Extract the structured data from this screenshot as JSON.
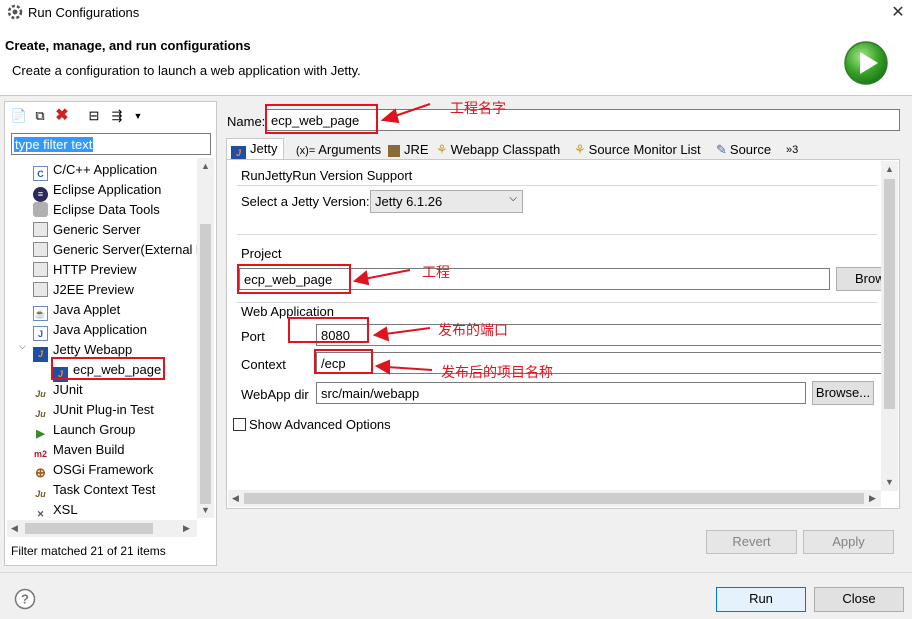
{
  "window": {
    "title": "Run Configurations",
    "close": "✕"
  },
  "header": {
    "title": "Create, manage, and run configurations",
    "subtitle": "Create a configuration to launch a web application with Jetty."
  },
  "left": {
    "filter_text": "type filter text",
    "tree": [
      {
        "label": "C/C++ Application",
        "icon": "c-icon"
      },
      {
        "label": "Eclipse Application",
        "icon": "eclipse-icon"
      },
      {
        "label": "Eclipse Data Tools",
        "icon": "database-icon"
      },
      {
        "label": "Generic Server",
        "icon": "server-icon"
      },
      {
        "label": "Generic Server(External l",
        "icon": "server-icon"
      },
      {
        "label": "HTTP Preview",
        "icon": "server-icon"
      },
      {
        "label": "J2EE Preview",
        "icon": "server-icon"
      },
      {
        "label": "Java Applet",
        "icon": "applet-icon"
      },
      {
        "label": "Java Application",
        "icon": "java-app-icon"
      },
      {
        "label": "Jetty Webapp",
        "icon": "jetty-icon"
      },
      {
        "label": "ecp_web_page",
        "icon": "jetty-icon"
      },
      {
        "label": "JUnit",
        "icon": "junit-icon"
      },
      {
        "label": "JUnit Plug-in Test",
        "icon": "junit-plugin-icon"
      },
      {
        "label": "Launch Group",
        "icon": "launch-group-icon"
      },
      {
        "label": "Maven Build",
        "icon": "maven-icon"
      },
      {
        "label": "OSGi Framework",
        "icon": "osgi-icon"
      },
      {
        "label": "Task Context Test",
        "icon": "task-icon"
      },
      {
        "label": "XSL",
        "icon": "xsl-icon"
      }
    ],
    "status": "Filter matched 21 of 21 items"
  },
  "right": {
    "name_label": "Name:",
    "name_value": "ecp_web_page",
    "tabs": [
      {
        "label": "Jetty",
        "icon": "jetty-icon"
      },
      {
        "label": "Arguments",
        "icon": "arguments-icon"
      },
      {
        "label": "JRE",
        "icon": "jre-icon"
      },
      {
        "label": "Webapp Classpath",
        "icon": "classpath-icon"
      },
      {
        "label": "Source Monitor List",
        "icon": "monitor-icon"
      },
      {
        "label": "Source",
        "icon": "source-icon"
      }
    ],
    "tabs_overflow": "»3",
    "version_group": "RunJettyRun Version Support",
    "version_label": "Select a Jetty Version:",
    "version_value": "Jetty 6.1.26",
    "project_group": "Project",
    "project_value": "ecp_web_page",
    "project_browse": "Brow",
    "webapp_group": "Web Application",
    "port_label": "Port",
    "port_value": "8080",
    "context_label": "Context",
    "context_value": "/ecp",
    "webappdir_label": "WebApp dir",
    "webappdir_value": "src/main/webapp",
    "webappdir_browse": "Browse...",
    "advanced_label": "Show Advanced Options",
    "revert": "Revert",
    "apply": "Apply"
  },
  "annotations": {
    "project_name": "工程名字",
    "project": "工程",
    "port": "发布的端口",
    "context": "发布后的项目名称"
  },
  "footer": {
    "run": "Run",
    "close": "Close"
  },
  "colors": {
    "annotation": "#e0141e",
    "selection": "#3399ff",
    "accent_button_border": "#0078d7"
  }
}
